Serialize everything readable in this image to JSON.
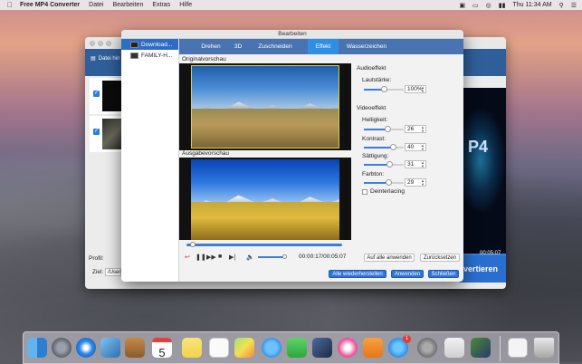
{
  "menubar": {
    "app_name": "Free MP4 Converter",
    "items": [
      "Datei",
      "Bearbeiten",
      "Extras",
      "Hilfe"
    ],
    "clock": "Thu 11:34 AM"
  },
  "main_window": {
    "add_file_label": "Datei hin",
    "profile_label": "Profil:",
    "target_label": "Ziel:",
    "target_value": "/User",
    "preview_text": "P4",
    "preview_time": "00:05:07",
    "convert_label": "vertieren"
  },
  "dialog": {
    "title": "Bearbeiten",
    "tabs": [
      "Drehen",
      "3D",
      "Zuschneiden",
      "Effekt",
      "Wasserzeichen"
    ],
    "active_tab": "Effekt",
    "files": [
      "Download...",
      "FAMILY-H..."
    ],
    "original_label": "Originalvorschau",
    "output_label": "Ausgabevorschau",
    "timecode": "00:00:17/00:05:07",
    "audio_section": "Audioeffekt",
    "volume_label": "Lautstärke:",
    "volume_value": "100%",
    "video_section": "Videoeffekt",
    "brightness_label": "Helligkeit:",
    "brightness_value": "26",
    "contrast_label": "Kontrast:",
    "contrast_value": "40",
    "saturation_label": "Sättigung:",
    "saturation_value": "31",
    "hue_label": "Farbton:",
    "hue_value": "29",
    "deinterlace_label": "Deinterlacing",
    "apply_all": "Auf alle anwenden",
    "reset": "Zurücksetzen",
    "restore_all": "Alle wiederherstellen",
    "apply": "Anwenden",
    "close": "Schließen"
  },
  "dock": {
    "calendar_day": "5",
    "appstore_badge": "1"
  }
}
